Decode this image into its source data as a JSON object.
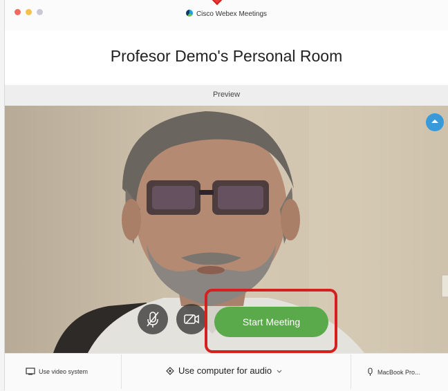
{
  "window": {
    "app_title": "Cisco Webex Meetings"
  },
  "room": {
    "title": "Profesor Demo's Personal Room"
  },
  "preview": {
    "label": "Preview"
  },
  "controls": {
    "start_meeting_label": "Start Meeting"
  },
  "bottom_bar": {
    "video_system_label": "Use video system",
    "audio_label": "Use computer for audio",
    "microphone_label": "MacBook Pro..."
  },
  "colors": {
    "accent_start": "#5aa94a",
    "annotation": "#d42020",
    "collapse_button": "#3a9ad9"
  },
  "icons": {
    "app_logo": "webex-logo-icon",
    "collapse": "chevron-up-icon",
    "mute": "microphone-muted-icon",
    "camera": "video-camera-icon",
    "video_system": "display-icon",
    "audio": "audio-connect-icon",
    "audio_dropdown": "chevron-down-icon",
    "microphone": "microphone-icon"
  }
}
